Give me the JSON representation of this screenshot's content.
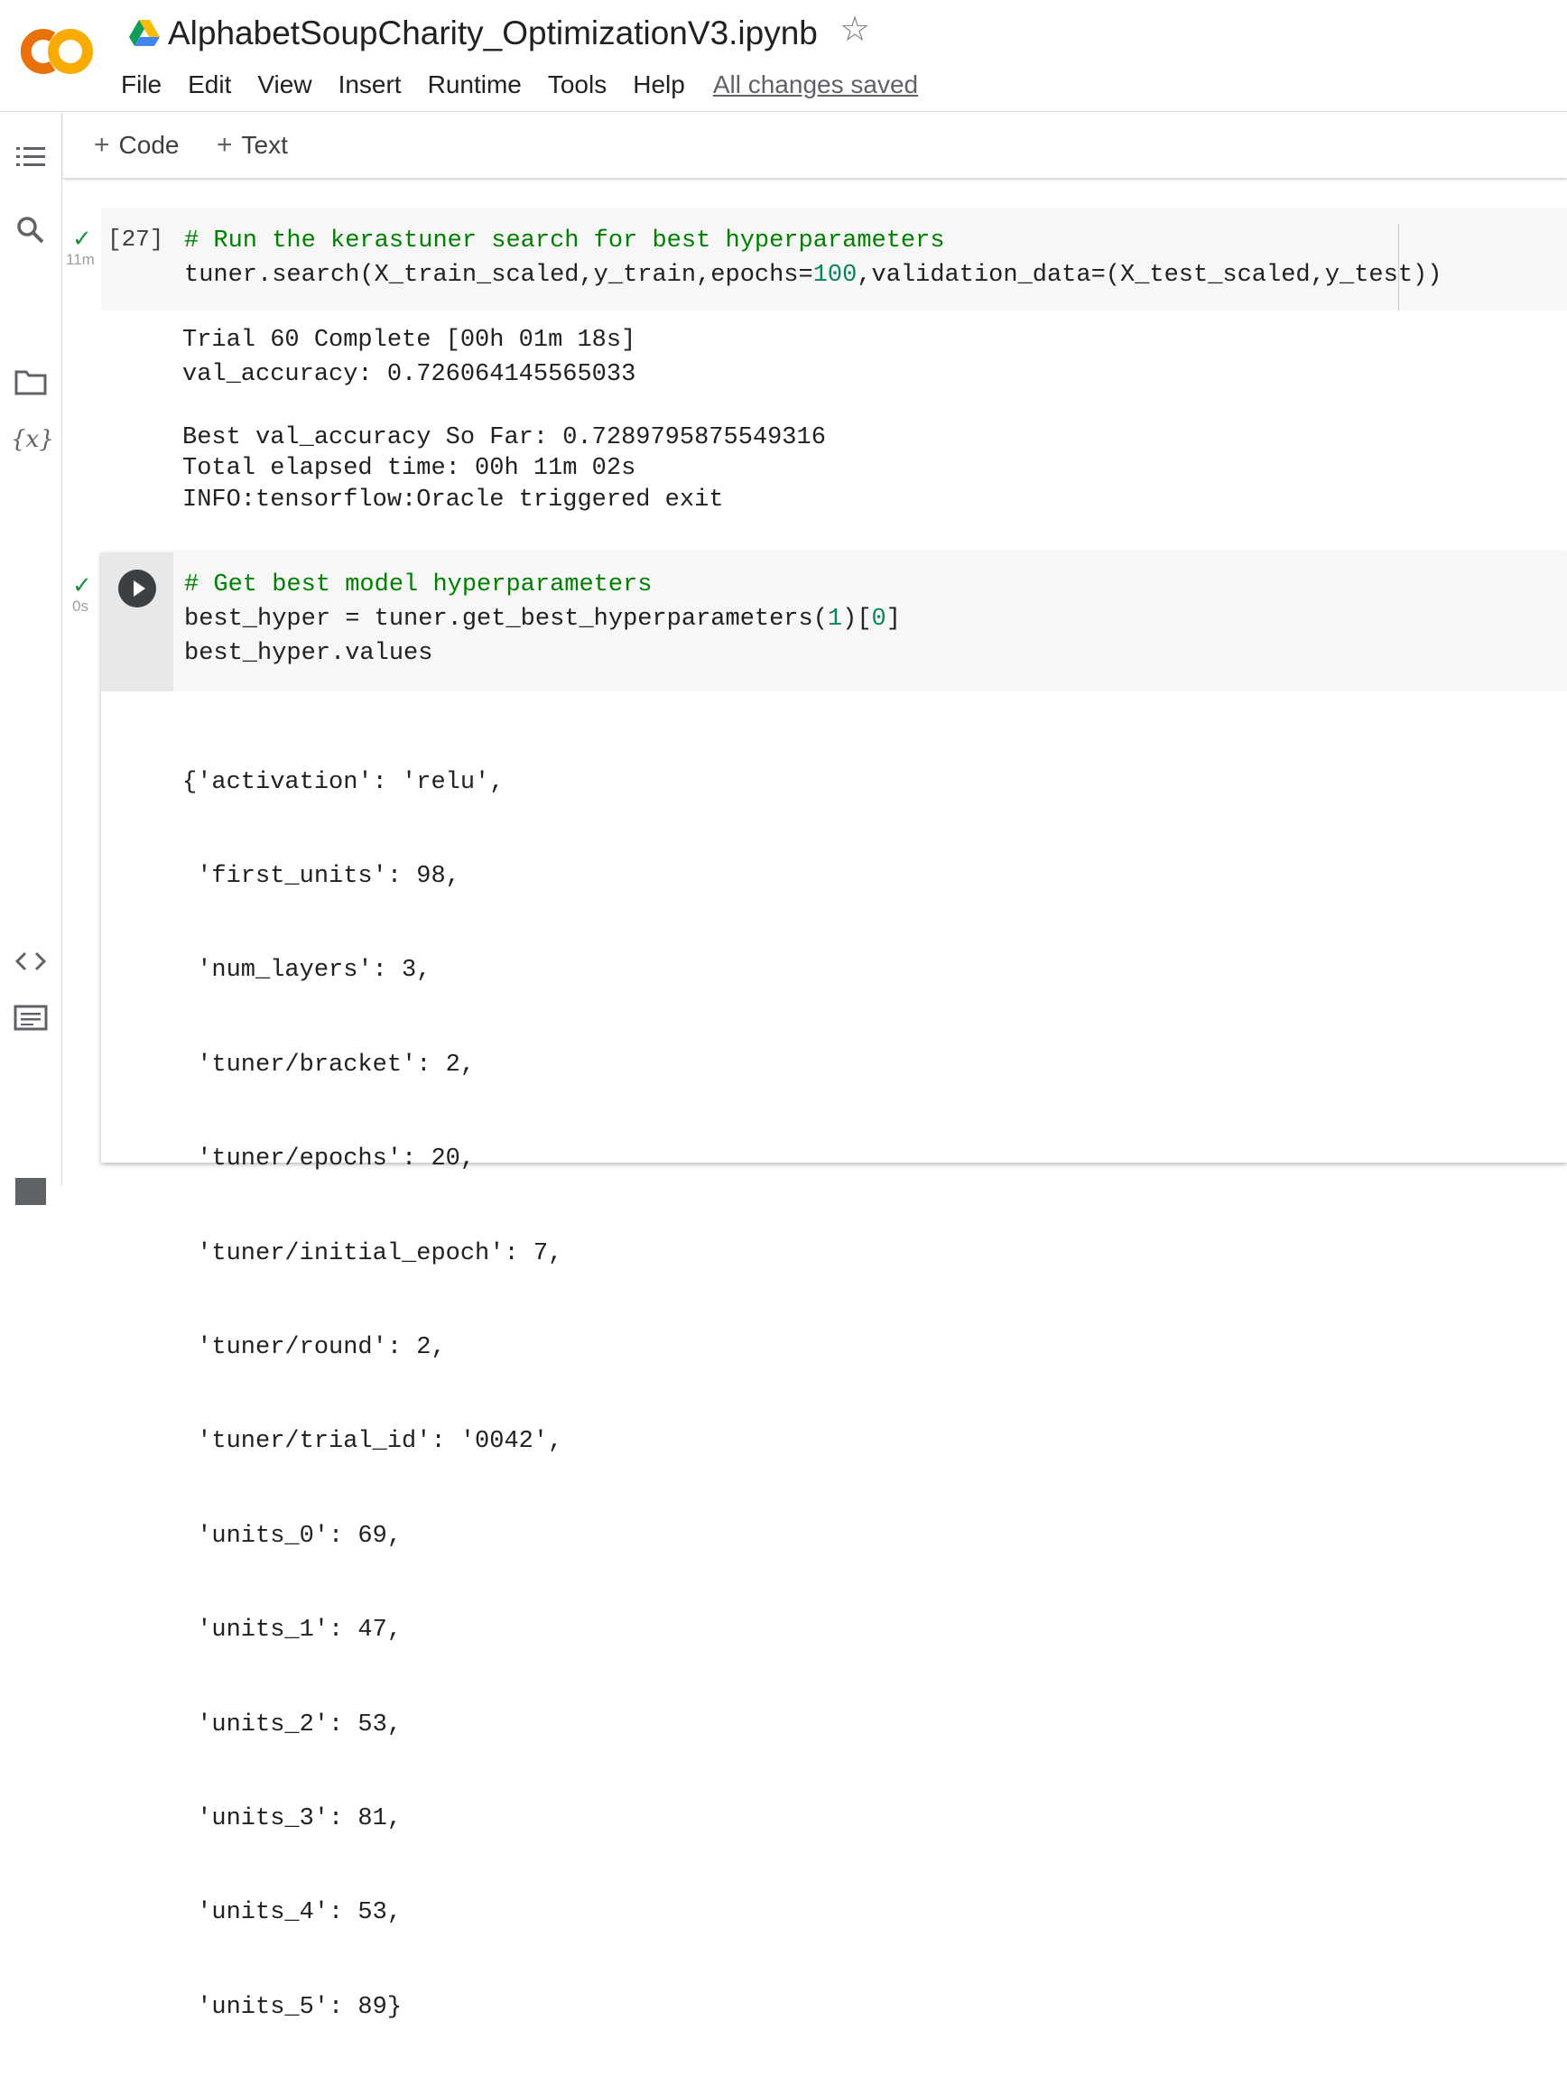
{
  "header": {
    "title": "AlphabetSoupCharity_OptimizationV3.ipynb",
    "menu": [
      "File",
      "Edit",
      "View",
      "Insert",
      "Runtime",
      "Tools",
      "Help"
    ],
    "save_status": "All changes saved"
  },
  "toolbar": {
    "code_label": "Code",
    "text_label": "Text"
  },
  "sidebar": {
    "icons": [
      "table-of-contents-icon",
      "search-icon",
      "variables-icon",
      "files-icon",
      "code-snippets-icon",
      "command-palette-icon",
      "terminal-icon"
    ],
    "variables_label": "{x}"
  },
  "cells": [
    {
      "execution_count": "[27]",
      "elapsed": "11m",
      "status": "success",
      "code": {
        "comment": "# Run the kerastuner search for best hyperparameters",
        "line2_a": "tuner.search(X_train_scaled,y_train,epochs=",
        "line2_num": "100",
        "line2_b": ",validation_data=(X_test_scaled,y_test))"
      },
      "output": [
        "Trial 60 Complete [00h 01m 18s]",
        "val_accuracy: 0.726064145565033",
        "",
        "Best val_accuracy So Far: 0.7289795875549316",
        "Total elapsed time: 00h 11m 02s",
        "INFO:tensorflow:Oracle triggered exit"
      ]
    },
    {
      "elapsed": "0s",
      "status": "success",
      "code": {
        "comment": "# Get best model hyperparameters",
        "line2_a": "best_hyper = tuner.get_best_hyperparameters(",
        "line2_num1": "1",
        "line2_mid": ")[",
        "line2_num2": "0",
        "line2_end": "]",
        "line3": "best_hyper.values"
      },
      "output": [
        "{'activation': 'relu',",
        " 'first_units': 98,",
        " 'num_layers': 3,",
        " 'tuner/bracket': 2,",
        " 'tuner/epochs': 20,",
        " 'tuner/initial_epoch': 7,",
        " 'tuner/round': 2,",
        " 'tuner/trial_id': '0042',",
        " 'units_0': 69,",
        " 'units_1': 47,",
        " 'units_2': 53,",
        " 'units_3': 81,",
        " 'units_4': 53,",
        " 'units_5': 89}"
      ]
    }
  ],
  "colors": {
    "comment": "#008000",
    "number": "#098658",
    "success": "#1e8e3e",
    "logo_orange": "#F9AB00",
    "logo_dark": "#E8710A"
  }
}
